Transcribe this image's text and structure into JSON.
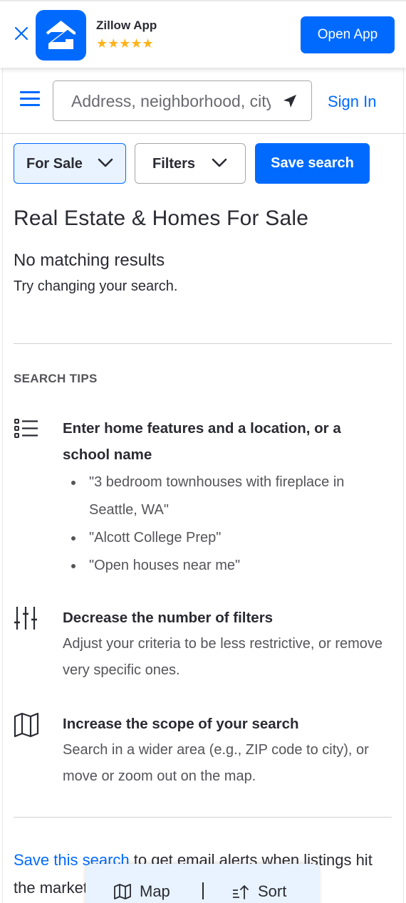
{
  "banner": {
    "app_name": "Zillow App",
    "stars": "★★★★★",
    "open_app_label": "Open App"
  },
  "header": {
    "search_placeholder": "Address, neighborhood, city, ZIP",
    "sign_in_label": "Sign In"
  },
  "filters": {
    "for_sale_label": "For Sale",
    "filters_label": "Filters",
    "save_search_label": "Save search"
  },
  "main": {
    "title": "Real Estate & Homes For Sale",
    "no_results": "No matching results",
    "try_changing": "Try changing your search."
  },
  "tips": {
    "heading": "SEARCH TIPS",
    "items": [
      {
        "icon": "list-icon",
        "title": "Enter home features and a location, or a school name",
        "examples": [
          "\"3 bedroom townhouses with fireplace in Seattle, WA\"",
          "\"Alcott College Prep\"",
          "\"Open houses near me\""
        ]
      },
      {
        "icon": "sliders-icon",
        "title": "Decrease the number of filters",
        "text": "Adjust your criteria to be less restrictive, or remove very specific ones."
      },
      {
        "icon": "map-icon",
        "title": "Increase the scope of your search",
        "text": "Search in a wider area (e.g., ZIP code to city), or move or zoom out on the map."
      }
    ]
  },
  "save_alert": {
    "link_text": "Save this search",
    "rest_text": " to get email alerts when listings hit the market."
  },
  "bottom_bar": {
    "map_label": "Map",
    "sort_label": "Sort"
  },
  "colors": {
    "accent": "#006aff",
    "text": "#2a2a33",
    "muted": "#54545a",
    "star": "#ffb31a",
    "selected_bg": "#e8f3ff"
  }
}
